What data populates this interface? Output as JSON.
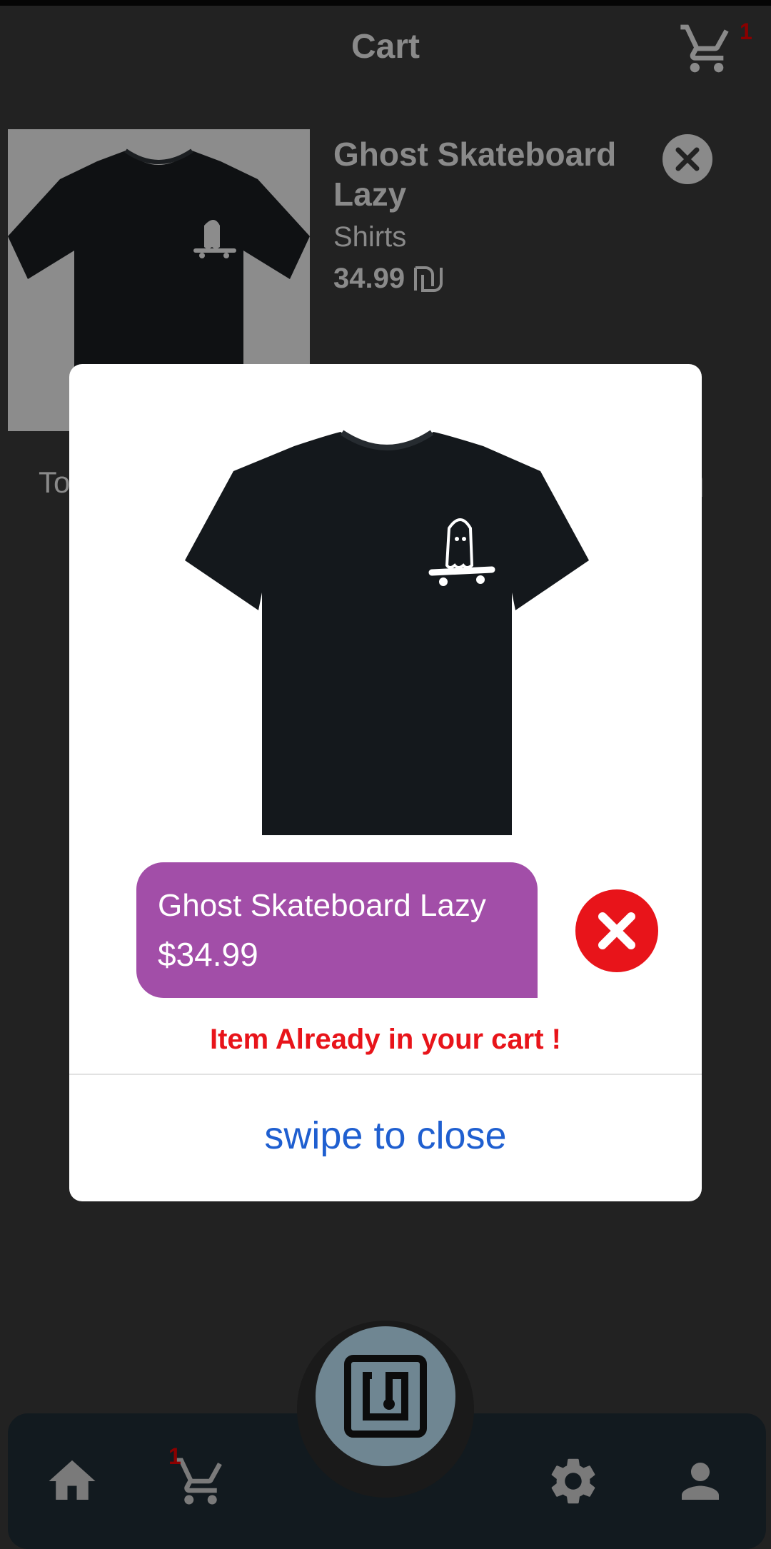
{
  "header": {
    "title": "Cart",
    "cart_count": "1"
  },
  "cart_item": {
    "name": "Ghost Skateboard Lazy",
    "category": "Shirts",
    "price": "34.99",
    "image_icon": "tshirt-image"
  },
  "total": {
    "label_partial": "To"
  },
  "modal": {
    "product_name": "Ghost Skateboard Lazy",
    "product_price": "$34.99",
    "message": "Item Already in your cart !",
    "close_label": "swipe to close",
    "colors": {
      "pill": "#a24ea8",
      "error": "#e8141a",
      "link": "#1f5fd0"
    }
  },
  "nav": {
    "items": [
      "home-icon",
      "cart-icon",
      "nfc-icon",
      "gear-icon",
      "person-icon"
    ],
    "cart_badge": "1"
  }
}
